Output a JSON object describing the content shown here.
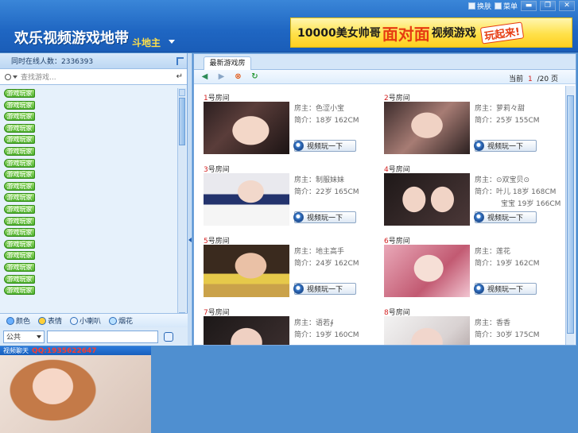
{
  "header": {
    "logo": "欢乐视频游戏地带",
    "logo_sub": "斗地主",
    "menu": [
      {
        "label": "换肤",
        "icon": "skin-icon"
      },
      {
        "label": "菜单",
        "icon": "menu-icon"
      }
    ],
    "window_buttons": [
      "▬",
      "❐",
      "✕"
    ],
    "banner": {
      "part1": "10000美女帅哥",
      "part2": "面对面",
      "part3": "视频游戏",
      "part4": "玩起来!"
    }
  },
  "sidebar": {
    "online_label": "同时在线人数：2336393",
    "search_placeholder": "查找游戏...",
    "player_tag": "游戏玩家",
    "player_count": 18,
    "chat_tools": [
      {
        "label": "颜色",
        "icon": "color-icon"
      },
      {
        "label": "表情",
        "icon": "emoji-icon"
      },
      {
        "label": "小喇叭",
        "icon": "speaker-icon"
      },
      {
        "label": "烟花",
        "icon": "fireworks-icon"
      }
    ],
    "channel": "公共"
  },
  "video_chat": {
    "title": "视频聊天",
    "qq": "QQ:1935622647"
  },
  "main": {
    "tab": "最新游戏房",
    "pager": {
      "prefix": "当前",
      "current": "1",
      "total": "/20",
      "suffix": "页"
    },
    "room_button": "视频玩一下",
    "room_suffix": "号房间",
    "rooms": [
      {
        "num": "1",
        "host": "房主：色涩小宝",
        "intro": "简介：18岁 162CM",
        "extra": ""
      },
      {
        "num": "2",
        "host": "房主：萝莉々甜",
        "intro": "简介：25岁 155CM",
        "extra": ""
      },
      {
        "num": "3",
        "host": "房主：制服妹妹",
        "intro": "简介：22岁 165CM",
        "extra": ""
      },
      {
        "num": "4",
        "host": "房主：⊙双宝贝⊙",
        "intro": "简介：叶儿 18岁 168CM",
        "extra": "宝宝 19岁 166CM"
      },
      {
        "num": "5",
        "host": "房主：地主高手",
        "intro": "简介：24岁 162CM",
        "extra": ""
      },
      {
        "num": "6",
        "host": "房主：莲花",
        "intro": "简介：19岁 162CM",
        "extra": ""
      },
      {
        "num": "7",
        "host": "房主：语若∮",
        "intro": "简介：19岁 160CM",
        "extra": ""
      },
      {
        "num": "8",
        "host": "房主：香香",
        "intro": "简介：30岁 175CM",
        "extra": ""
      }
    ]
  }
}
